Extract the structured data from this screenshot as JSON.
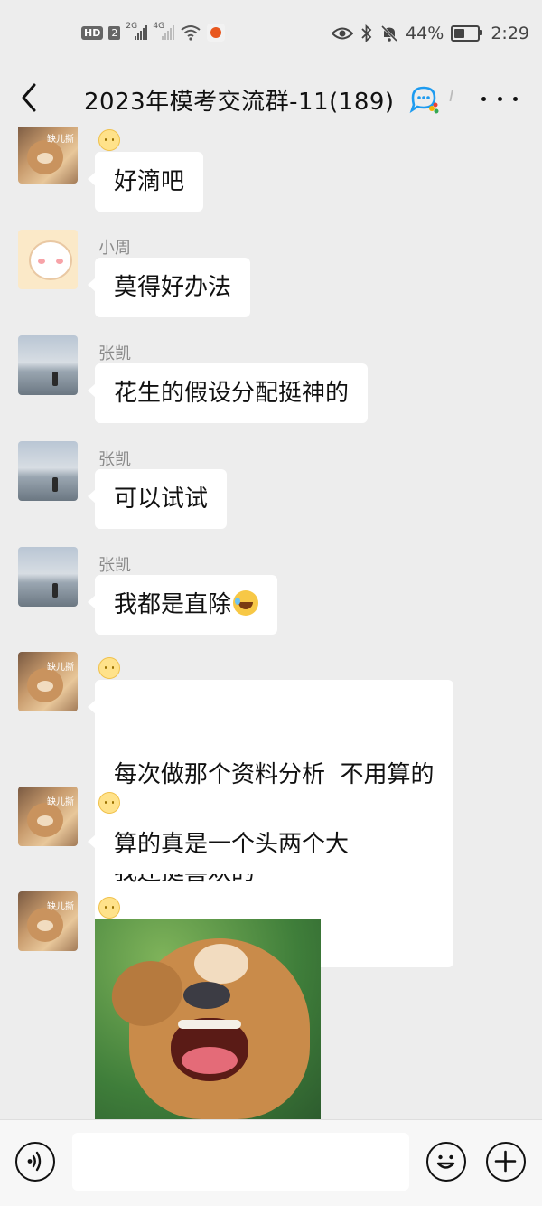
{
  "status_bar": {
    "hd": "HD",
    "sim": "2",
    "net1": "2G",
    "net2": "4G",
    "battery_percent_label": "44%",
    "battery_level": 0.44,
    "time": "2:29"
  },
  "header": {
    "title": "2023年模考交流群-11(189)",
    "title_mark": "Ⅰ"
  },
  "messages": [
    {
      "sender_icon": "smile-emoji",
      "text": "好滴吧",
      "avatar": "bear-avatar"
    },
    {
      "sender": "小周",
      "text": "莫得好办法",
      "avatar": "bunny-avatar"
    },
    {
      "sender": "张凯",
      "text": "花生的假设分配挺神的",
      "avatar": "sea-avatar"
    },
    {
      "sender": "张凯",
      "text": "可以试试",
      "avatar": "sea-avatar"
    },
    {
      "sender": "张凯",
      "text": "我都是直除",
      "avatar": "sea-avatar",
      "trailing_emoji": "laugh-cry-emoji"
    },
    {
      "sender_icon": "smile-emoji",
      "text_line1": "每次做那个资料分析  不用算的",
      "text_line2": "我还挺喜欢的",
      "avatar": "bear-avatar"
    },
    {
      "sender_icon": "smile-emoji",
      "text": "算的真是一个头两个大",
      "avatar": "bear-avatar"
    },
    {
      "sender_icon": "smile-emoji",
      "sticker": "bear-facepalm-sticker",
      "avatar": "bear-avatar"
    }
  ],
  "bear_avatar_tag": "缺儿撕",
  "input_bar": {
    "placeholder": ""
  },
  "colors": {
    "background": "#ededed",
    "bubble": "#ffffff",
    "sender_name": "#8a8a8a"
  }
}
